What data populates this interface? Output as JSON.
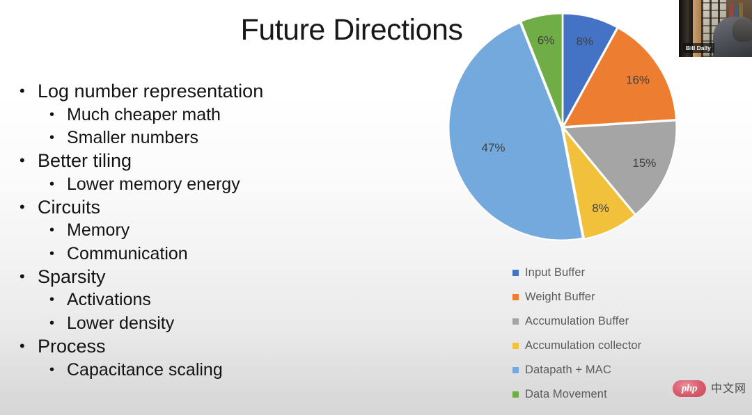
{
  "slide": {
    "title": "Future Directions",
    "bullets": [
      {
        "level": 1,
        "text": "Log number representation",
        "marker": "•"
      },
      {
        "level": 2,
        "text": "Much cheaper math",
        "marker": "•"
      },
      {
        "level": 2,
        "text": "Smaller numbers",
        "marker": "•"
      },
      {
        "level": 1,
        "text": "Better tiling",
        "marker": "•"
      },
      {
        "level": 2,
        "text": "Lower memory energy",
        "marker": "•"
      },
      {
        "level": 1,
        "text": "Circuits",
        "marker": "•"
      },
      {
        "level": 2,
        "text": "Memory",
        "marker": "•"
      },
      {
        "level": 2,
        "text": "Communication",
        "marker": "•"
      },
      {
        "level": 1,
        "text": "Sparsity",
        "marker": "•"
      },
      {
        "level": 2,
        "text": "Activations",
        "marker": "•"
      },
      {
        "level": 2,
        "text": "Lower density",
        "marker": "•"
      },
      {
        "level": 1,
        "text": "Process",
        "marker": "•"
      },
      {
        "level": 2,
        "text": "Capacitance scaling",
        "marker": "•"
      }
    ]
  },
  "chart_data": {
    "type": "pie",
    "title": "",
    "legend_position": "bottom",
    "categories": [
      "Input Buffer",
      "Weight Buffer",
      "Accumulation Buffer",
      "Accumulation collector",
      "Datapath + MAC",
      "Data Movement"
    ],
    "values": [
      8,
      16,
      15,
      8,
      47,
      6
    ],
    "value_labels": [
      "8%",
      "16%",
      "15%",
      "8%",
      "47%",
      "6%"
    ],
    "colors": [
      "#4472C4",
      "#ED7D31",
      "#A5A5A5",
      "#F2C13C",
      "#73A9DC",
      "#70AD47"
    ],
    "start_angle_deg": 0,
    "direction": "clockwise",
    "units": "percent"
  },
  "webcam": {
    "name_label": "Bill Dally"
  },
  "watermark": {
    "php_text": "php",
    "cn_text": "中文网"
  }
}
